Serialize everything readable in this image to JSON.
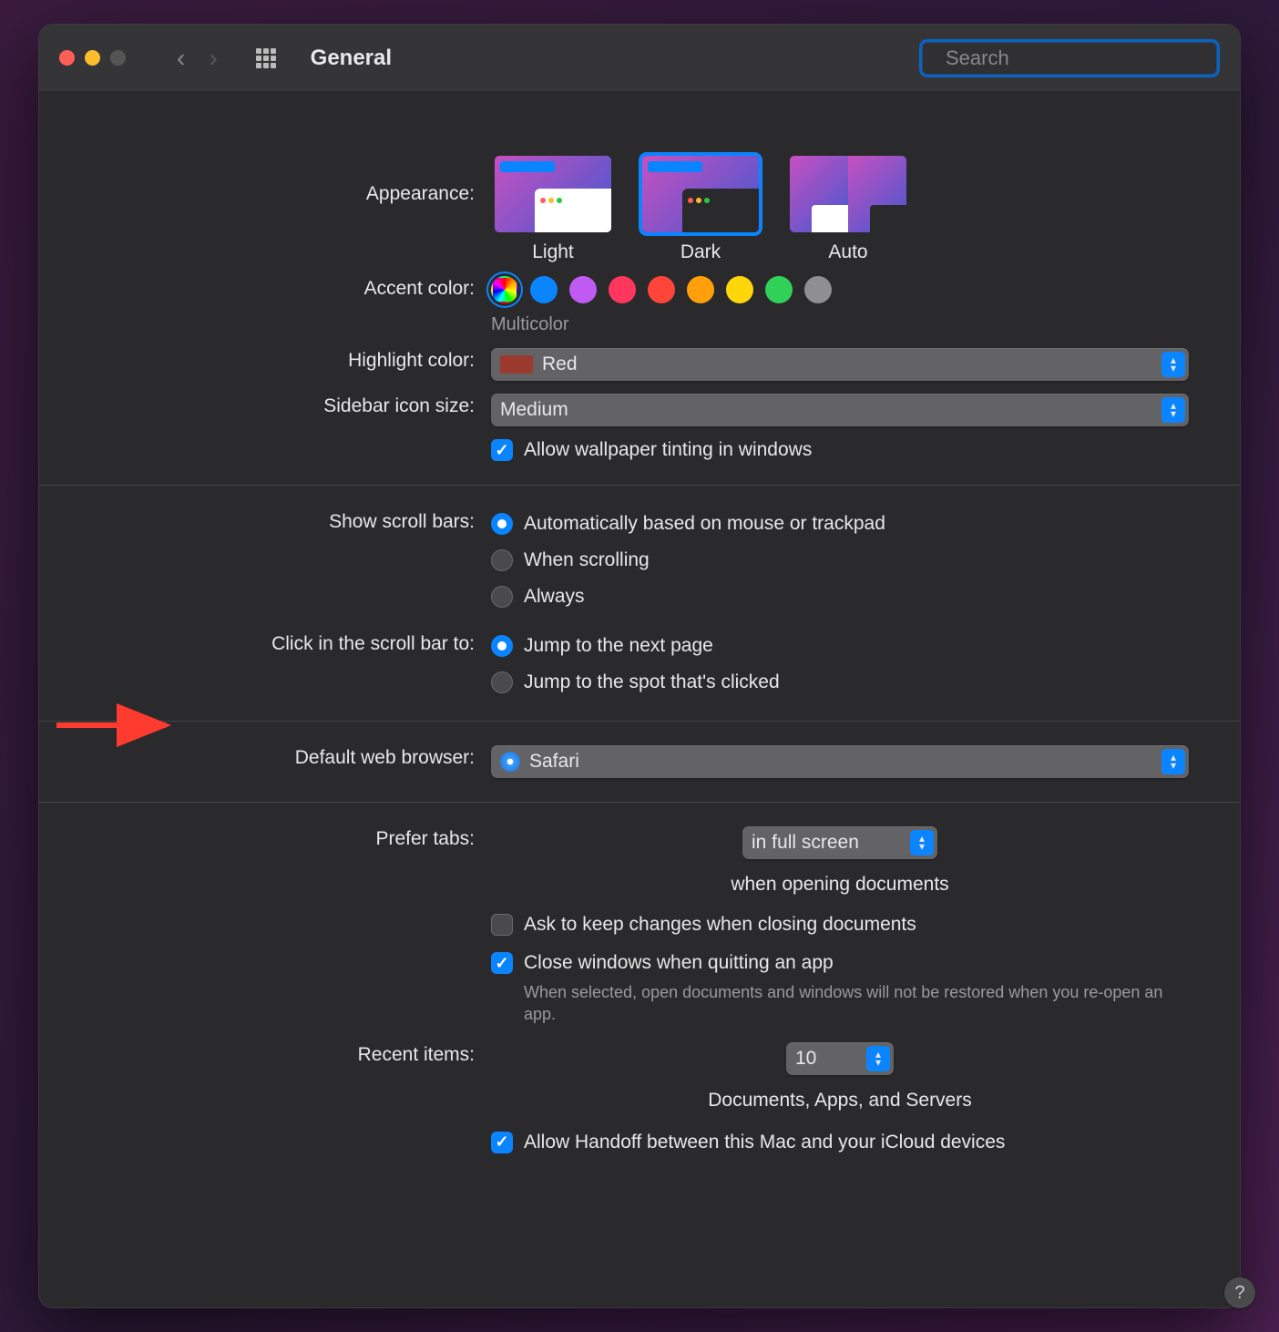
{
  "window": {
    "title": "General",
    "search_placeholder": "Search"
  },
  "appearance": {
    "label": "Appearance:",
    "options": [
      "Light",
      "Dark",
      "Auto"
    ],
    "selected": "Dark"
  },
  "accent": {
    "label": "Accent color:",
    "caption": "Multicolor"
  },
  "highlight": {
    "label": "Highlight color:",
    "value": "Red"
  },
  "sidebar_size": {
    "label": "Sidebar icon size:",
    "value": "Medium"
  },
  "wallpaper_tint": {
    "label": "Allow wallpaper tinting in windows"
  },
  "scroll": {
    "show_label": "Show scroll bars:",
    "show_options": [
      "Automatically based on mouse or trackpad",
      "When scrolling",
      "Always"
    ],
    "click_label": "Click in the scroll bar to:",
    "click_options": [
      "Jump to the next page",
      "Jump to the spot that's clicked"
    ]
  },
  "browser": {
    "label": "Default web browser:",
    "value": "Safari"
  },
  "tabs": {
    "label": "Prefer tabs:",
    "value": "in full screen",
    "suffix": "when opening documents",
    "ask_changes": "Ask to keep changes when closing documents",
    "close_windows": "Close windows when quitting an app",
    "close_help": "When selected, open documents and windows will not be restored when you re-open an app."
  },
  "recent": {
    "label": "Recent items:",
    "value": "10",
    "suffix": "Documents, Apps, and Servers"
  },
  "handoff": {
    "label": "Allow Handoff between this Mac and your iCloud devices"
  },
  "help": "?"
}
